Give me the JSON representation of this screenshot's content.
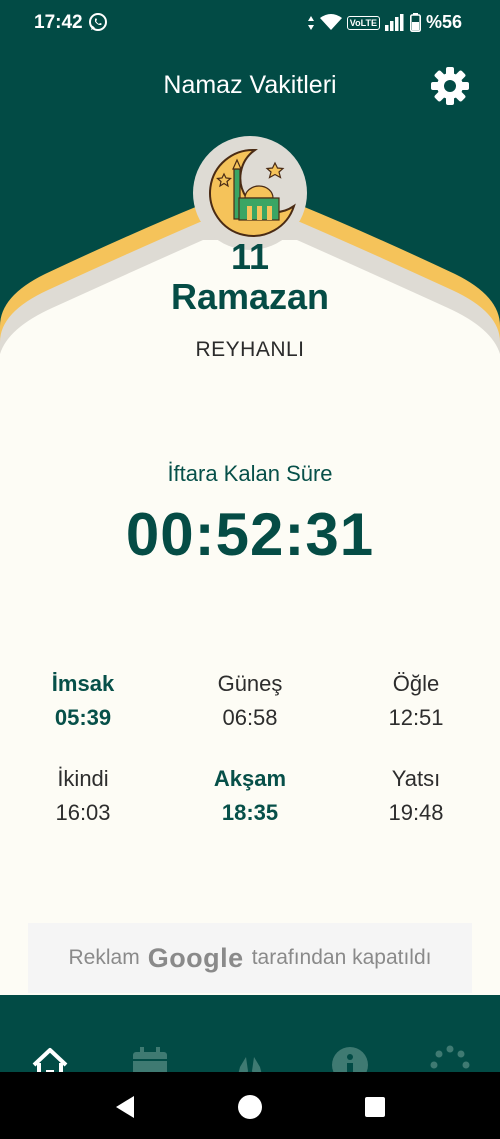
{
  "status_bar": {
    "time": "17:42",
    "network": "VoLTE",
    "battery": "%56"
  },
  "header": {
    "title": "Namaz Vakitleri"
  },
  "hijri": {
    "day": "11",
    "month": "Ramazan"
  },
  "location": {
    "city": "REYHANLI"
  },
  "countdown": {
    "label": "İftara Kalan Süre",
    "value": "00:52:31"
  },
  "prayers": [
    {
      "name": "İmsak",
      "time": "05:39",
      "highlighted": true
    },
    {
      "name": "Güneş",
      "time": "06:58",
      "highlighted": false
    },
    {
      "name": "Öğle",
      "time": "12:51",
      "highlighted": false
    },
    {
      "name": "İkindi",
      "time": "16:03",
      "highlighted": false
    },
    {
      "name": "Akşam",
      "time": "18:35",
      "highlighted": true
    },
    {
      "name": "Yatsı",
      "time": "19:48",
      "highlighted": false
    }
  ],
  "ad": {
    "prefix": "Reklam",
    "brand": "Google",
    "suffix": "tarafından kapatıldı"
  },
  "bottom_nav": [
    "home-icon",
    "calendar-icon",
    "prayer-hands-icon",
    "info-icon",
    "more-icon"
  ],
  "colors": {
    "primary": "#024b45",
    "accent": "#f5c35a",
    "background": "#fdfcf5",
    "arch_gray": "#dedbd4"
  }
}
